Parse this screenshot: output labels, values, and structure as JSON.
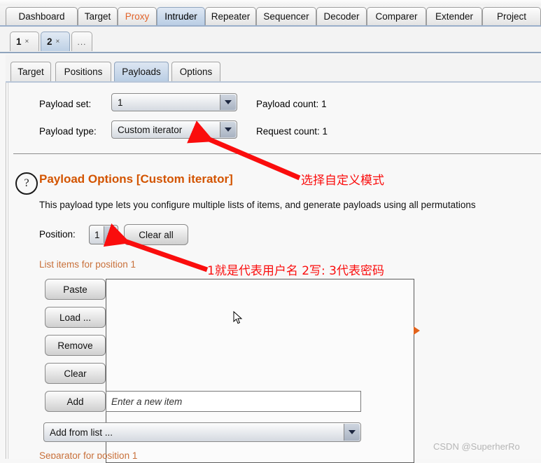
{
  "window": {
    "main_tabs": [
      {
        "label": "Dashboard",
        "selected": false,
        "accent": false
      },
      {
        "label": "Target",
        "selected": false,
        "accent": false
      },
      {
        "label": "Proxy",
        "selected": false,
        "accent": true
      },
      {
        "label": "Intruder",
        "selected": true,
        "accent": false
      },
      {
        "label": "Repeater",
        "selected": false,
        "accent": false
      },
      {
        "label": "Sequencer",
        "selected": false,
        "accent": false
      },
      {
        "label": "Decoder",
        "selected": false,
        "accent": false
      },
      {
        "label": "Comparer",
        "selected": false,
        "accent": false
      },
      {
        "label": "Extender",
        "selected": false,
        "accent": false
      },
      {
        "label": "Project",
        "selected": false,
        "accent": false
      }
    ],
    "attack_tabs": [
      {
        "label": "1",
        "close": "×",
        "selected": false
      },
      {
        "label": "2",
        "close": "×",
        "selected": true
      }
    ],
    "attack_tab_more": "...",
    "sub_tabs": [
      {
        "label": "Target",
        "selected": false
      },
      {
        "label": "Positions",
        "selected": false
      },
      {
        "label": "Payloads",
        "selected": true
      },
      {
        "label": "Options",
        "selected": false
      }
    ]
  },
  "payload_config": {
    "payload_set_label": "Payload set:",
    "payload_set_value": "1",
    "payload_type_label": "Payload type:",
    "payload_type_value": "Custom iterator",
    "payload_count_label": "Payload count: 1",
    "request_count_label": "Request count: 1"
  },
  "payload_options": {
    "help_icon_glyph": "?",
    "title": "Payload Options [Custom iterator]",
    "description": "This payload type lets you configure multiple lists of items, and generate payloads using all permutations",
    "position_label": "Position:",
    "position_value": "1",
    "clear_all_label": "Clear all",
    "list_items_label": "List items for position 1",
    "buttons": [
      {
        "label": "Paste"
      },
      {
        "label": "Load ..."
      },
      {
        "label": "Remove"
      },
      {
        "label": "Clear"
      },
      {
        "label": "Add"
      }
    ],
    "new_item_placeholder": "Enter a new item",
    "new_item_value": "",
    "add_from_list_label": "Add from list ...",
    "separator_label_clipped": "Separator for position 1"
  },
  "annotations": {
    "note_payload_type": "选择自定义模式",
    "note_position": "1就是代表用户名 2写: 3代表密码",
    "arrow_color": "#fa0d0d"
  },
  "watermark": {
    "text": "CSDN @SuperherRo"
  },
  "colors": {
    "accent_orange": "#d35400",
    "tab_selected": "#bdd0e5",
    "proxy_text": "#e2632a",
    "annotation_red": "#fa0d0d"
  }
}
